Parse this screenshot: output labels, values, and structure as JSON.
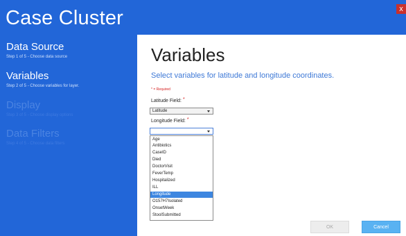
{
  "window": {
    "title": "Case Cluster",
    "close_glyph": "x"
  },
  "sidebar": {
    "steps": [
      {
        "title": "Data Source",
        "subtitle": "Step 1 of 5 - Choose data source",
        "state": "complete"
      },
      {
        "title": "Variables",
        "subtitle": "Step 2 of 5 - Choose variables for layer.",
        "state": "current"
      },
      {
        "title": "Display",
        "subtitle": "Step 3 of 5 - Choose display options",
        "state": "inactive"
      },
      {
        "title": "Data Filters",
        "subtitle": "Step 4 of 5 - Choose data filters",
        "state": "inactive"
      }
    ]
  },
  "main": {
    "title": "Variables",
    "subtitle": "Select variables for latitude and longitude coordinates.",
    "required_note": "* = Required",
    "latitude": {
      "label": "Latitude Field:",
      "required_mark": "*",
      "value": "Latitude"
    },
    "longitude": {
      "label": "Longitude Field:",
      "required_mark": "*",
      "value": "",
      "options": [
        "Age",
        "Antibiotics",
        "CaseID",
        "Died",
        "DoctorVisit",
        "FeverTemp",
        "Hospitalized",
        "ILL",
        "Longitude",
        "O157H7Isolated",
        "OnsetWeek",
        "StoolSubmitted"
      ],
      "highlighted_option": "Longitude"
    },
    "buttons": {
      "ok": "OK",
      "cancel": "Cancel"
    }
  },
  "colors": {
    "sidebar": "#2266d8",
    "highlight": "#3d86e0",
    "cancel_button": "#59b2f2",
    "required": "#d62020"
  }
}
